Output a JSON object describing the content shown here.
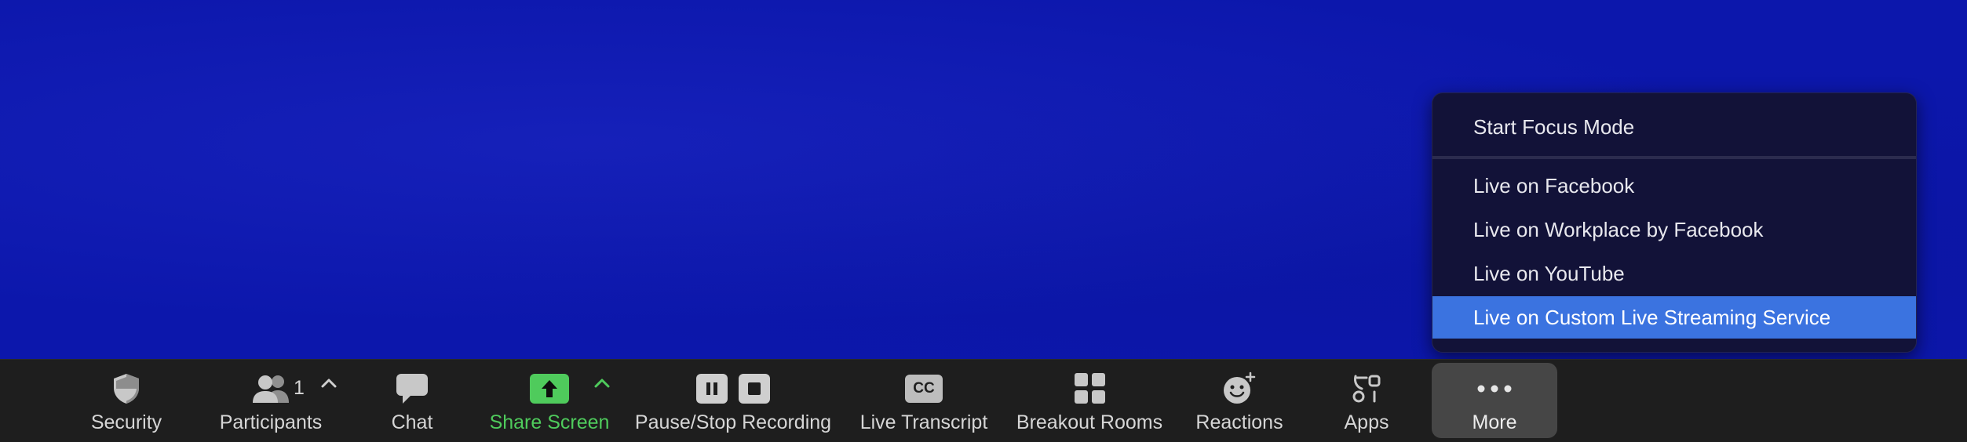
{
  "toolbar": {
    "security": "Security",
    "participants": "Participants",
    "participants_count": "1",
    "chat": "Chat",
    "share_screen": "Share Screen",
    "pause_stop_recording": "Pause/Stop Recording",
    "cc_badge": "CC",
    "live_transcript": "Live Transcript",
    "breakout_rooms": "Breakout Rooms",
    "reactions": "Reactions",
    "apps": "Apps",
    "more": "More"
  },
  "more_menu": {
    "items": [
      "Start Focus Mode",
      "Live on Facebook",
      "Live on Workplace by Facebook",
      "Live on YouTube",
      "Live on Custom Live Streaming Service"
    ],
    "selected": "Live on Custom Live Streaming Service"
  },
  "colors": {
    "video_background": "#0c17ac",
    "toolbar_background": "#1e1e1e",
    "share_screen_green": "#4fcb5c",
    "menu_background": "#121238",
    "menu_selected": "#3b73e0",
    "more_button_active": "#464646"
  },
  "icons": [
    "shield-icon",
    "participants-icon",
    "chevron-up-icon",
    "chat-bubble-icon",
    "share-arrow-icon",
    "pause-icon",
    "stop-icon",
    "cc-icon",
    "breakout-grid-icon",
    "reaction-smiley-icon",
    "apps-icon",
    "more-dots-icon"
  ]
}
